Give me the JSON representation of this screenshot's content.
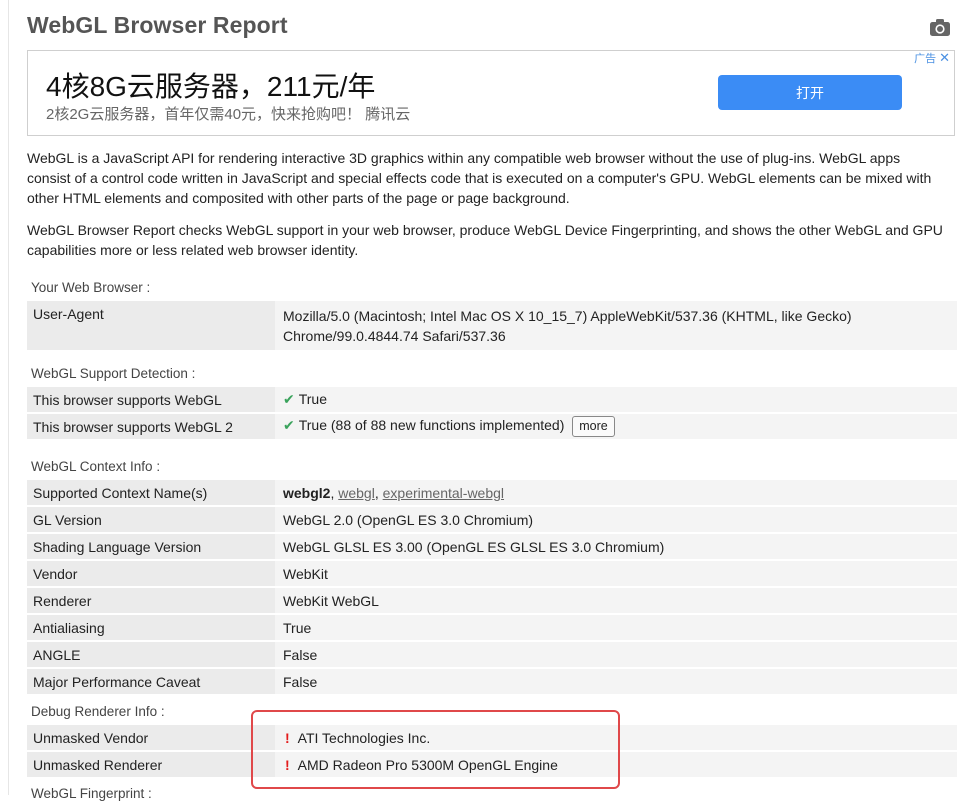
{
  "header": {
    "title": "WebGL Browser Report"
  },
  "ad": {
    "headline": "4核8G云服务器，211元/年",
    "subtext": "2核2G云服务器，首年仅需40元，快来抢购吧！  腾讯云",
    "badge": "广告",
    "button_label": "打开"
  },
  "intro": {
    "p1": "WebGL is a JavaScript API for rendering interactive 3D graphics within any compatible web browser without the use of plug-ins. WebGL apps consist of a control code written in JavaScript and special effects code that is executed on a computer's GPU. WebGL elements can be mixed with other HTML elements and composited with other parts of the page or page background.",
    "p2": "WebGL Browser Report checks WebGL support in your web browser, produce WebGL Device Fingerprinting, and shows the other WebGL and GPU capabilities more or less related web browser identity."
  },
  "browser": {
    "heading": "Your Web Browser :",
    "ua_key": "User-Agent",
    "ua_value": "Mozilla/5.0 (Macintosh; Intel Mac OS X 10_15_7) AppleWebKit/537.36 (KHTML, like Gecko) Chrome/99.0.4844.74 Safari/537.36"
  },
  "support": {
    "heading": "WebGL Support Detection :",
    "rows": [
      {
        "key": "This browser supports WebGL",
        "value": "True"
      },
      {
        "key": "This browser supports WebGL 2",
        "value": "True (88 of 88 new functions implemented)"
      }
    ],
    "more_label": "more",
    "check_glyph": "✔"
  },
  "context": {
    "heading": "WebGL Context Info :",
    "names_key": "Supported Context Name(s)",
    "names": [
      "webgl2",
      "webgl",
      "experimental-webgl"
    ],
    "rows": [
      {
        "key": "GL Version",
        "value": "WebGL 2.0 (OpenGL ES 3.0 Chromium)"
      },
      {
        "key": "Shading Language Version",
        "value": "WebGL GLSL ES 3.00 (OpenGL ES GLSL ES 3.0 Chromium)"
      },
      {
        "key": "Vendor",
        "value": "WebKit"
      },
      {
        "key": "Renderer",
        "value": "WebKit WebGL"
      },
      {
        "key": "Antialiasing",
        "value": "True"
      },
      {
        "key": "ANGLE",
        "value": "False"
      },
      {
        "key": "Major Performance Caveat",
        "value": "False"
      }
    ]
  },
  "debug": {
    "heading": "Debug Renderer Info :",
    "warn_glyph": "!",
    "rows": [
      {
        "key": "Unmasked Vendor",
        "value": "ATI Technologies Inc."
      },
      {
        "key": "Unmasked Renderer",
        "value": "AMD Radeon Pro 5300M OpenGL Engine"
      }
    ]
  },
  "fingerprint": {
    "heading": "WebGL Fingerprint :"
  },
  "colors": {
    "highlight": "#e0484a",
    "check": "#3aa35c",
    "warning": "#e31b1b",
    "ad_button": "#3b8cf5"
  }
}
